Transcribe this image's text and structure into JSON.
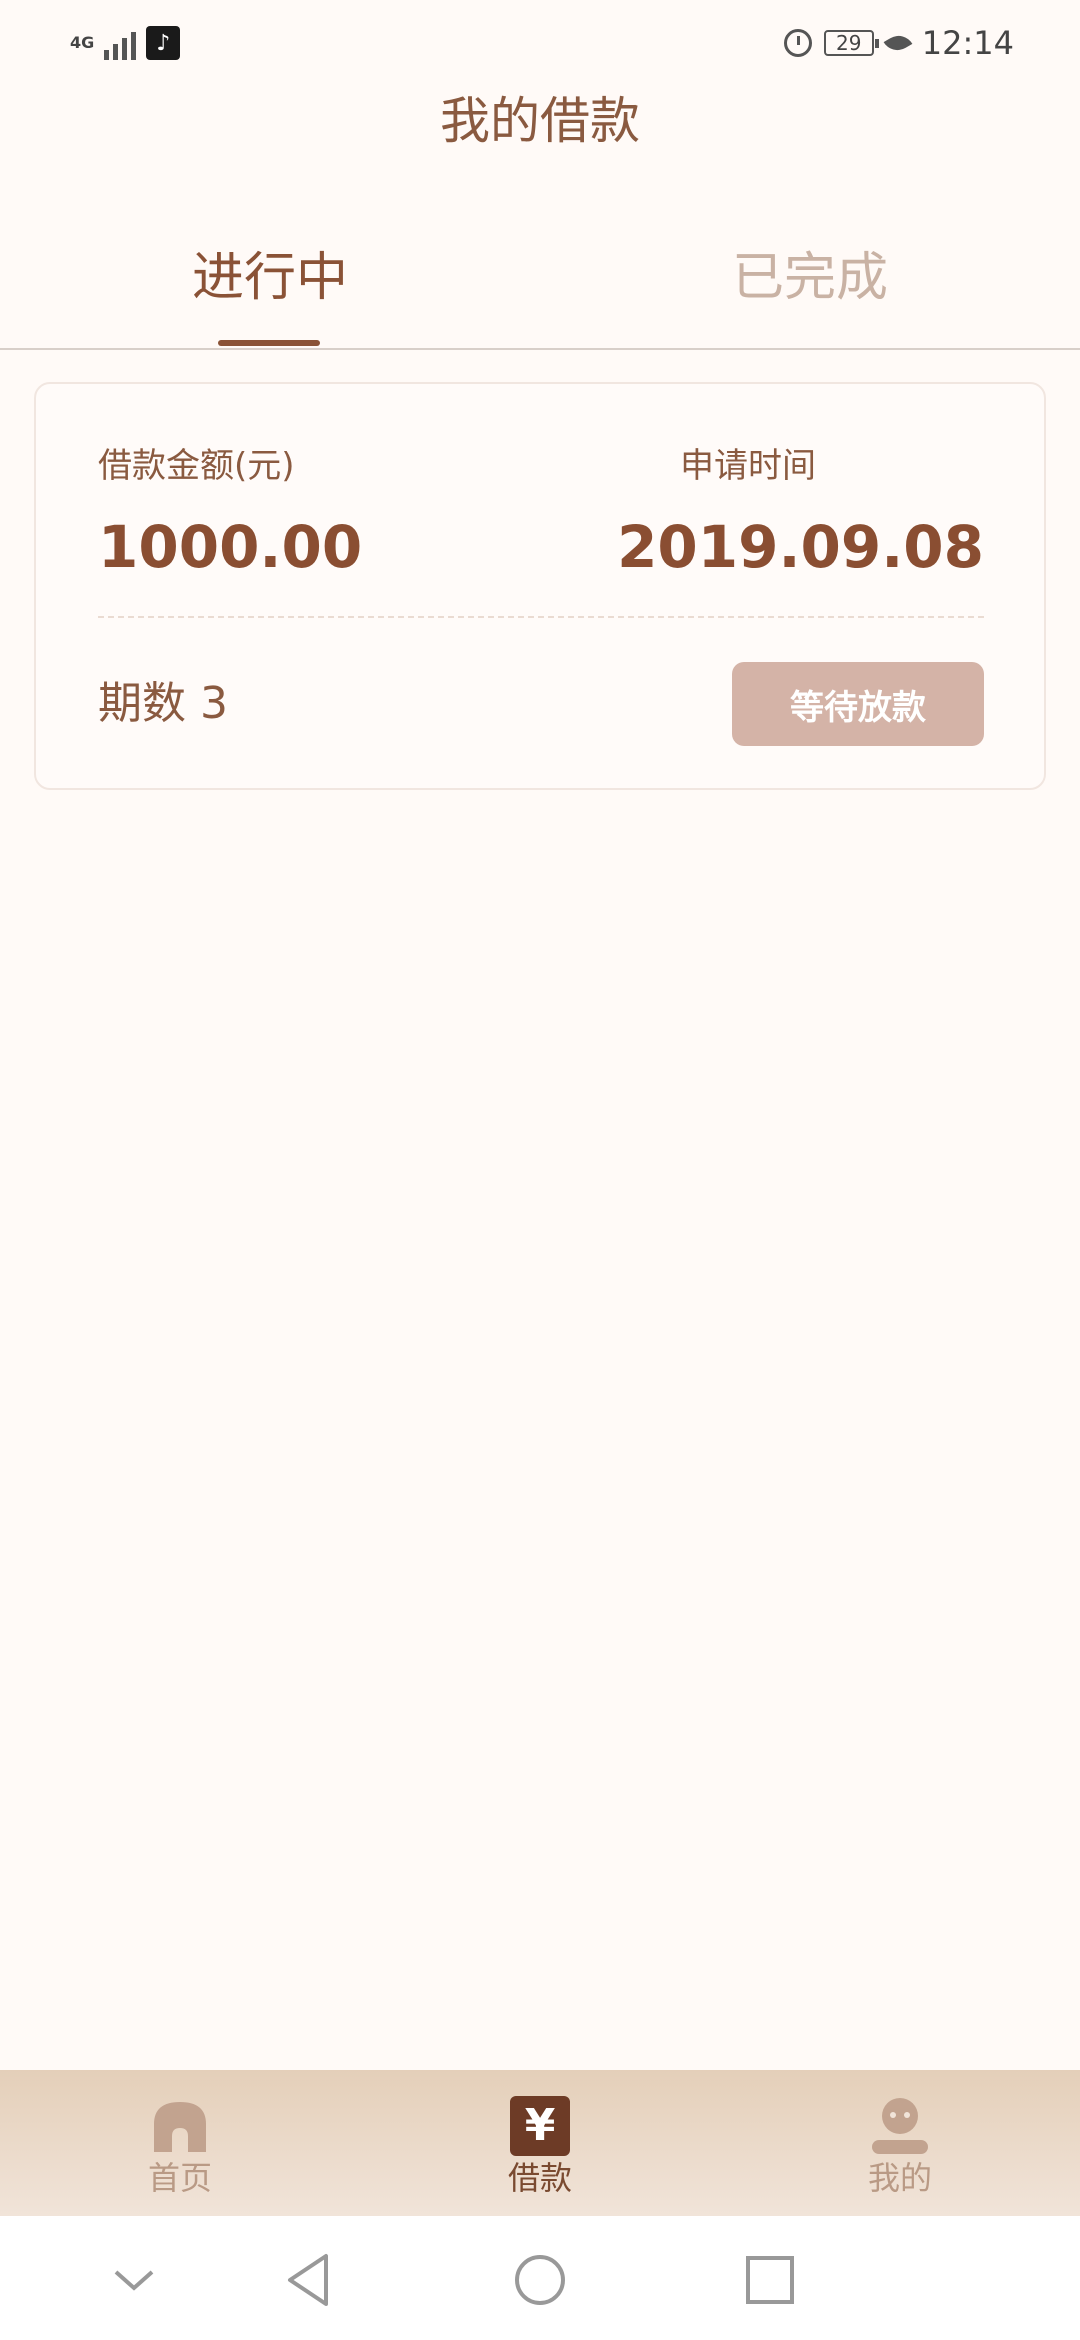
{
  "status_bar": {
    "network": "4G",
    "battery": "29",
    "time": "12:14",
    "icons": [
      "signal-icon",
      "tiktok-icon",
      "alarm-icon",
      "battery-icon",
      "leaf-icon"
    ]
  },
  "header": {
    "title": "我的借款"
  },
  "tabs": [
    {
      "label": "进行中",
      "active": true
    },
    {
      "label": "已完成",
      "active": false
    }
  ],
  "loan_card": {
    "amount_label": "借款金额(元)",
    "amount_value": "1000.00",
    "time_label": "申请时间",
    "time_value": "2019.09.08",
    "periods": "期数 3",
    "status_button": "等待放款"
  },
  "bottom_nav": {
    "items": [
      {
        "label": "首页",
        "icon": "home-icon",
        "active": false
      },
      {
        "label": "借款",
        "icon": "yuan-icon",
        "active": true
      },
      {
        "label": "我的",
        "icon": "profile-icon",
        "active": false
      }
    ]
  },
  "system_nav": {
    "icons": [
      "chevron-down-icon",
      "back-icon",
      "home-circle-icon",
      "recent-apps-icon"
    ]
  },
  "colors": {
    "background": "#fffaf7",
    "accent": "#8a5236",
    "button": "#d4b3a7",
    "nav_gradient_top": "#e4cfb9"
  }
}
